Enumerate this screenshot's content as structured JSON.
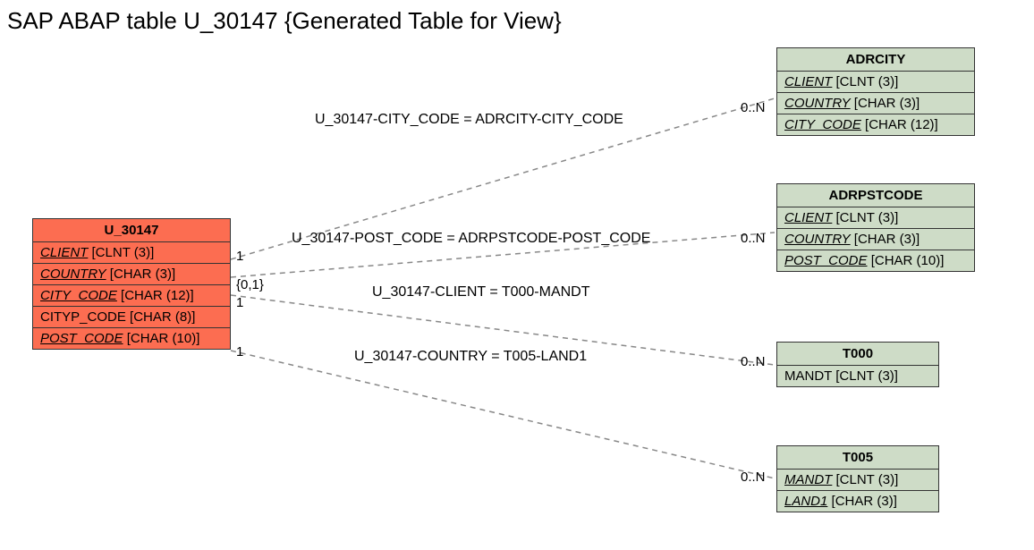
{
  "title": "SAP ABAP table U_30147 {Generated Table for View}",
  "main_table": {
    "name": "U_30147",
    "fields": [
      {
        "name": "CLIENT",
        "type": "[CLNT (3)]"
      },
      {
        "name": "COUNTRY",
        "type": "[CHAR (3)]"
      },
      {
        "name": "CITY_CODE",
        "type": "[CHAR (12)]"
      },
      {
        "name": "CITYP_CODE",
        "type": "[CHAR (8)]",
        "plain": true
      },
      {
        "name": "POST_CODE",
        "type": "[CHAR (10)]"
      }
    ]
  },
  "related_tables": [
    {
      "name": "ADRCITY",
      "fields": [
        {
          "name": "CLIENT",
          "type": "[CLNT (3)]"
        },
        {
          "name": "COUNTRY",
          "type": "[CHAR (3)]"
        },
        {
          "name": "CITY_CODE",
          "type": "[CHAR (12)]"
        }
      ]
    },
    {
      "name": "ADRPSTCODE",
      "fields": [
        {
          "name": "CLIENT",
          "type": "[CLNT (3)]"
        },
        {
          "name": "COUNTRY",
          "type": "[CHAR (3)]"
        },
        {
          "name": "POST_CODE",
          "type": "[CHAR (10)]"
        }
      ]
    },
    {
      "name": "T000",
      "fields": [
        {
          "name": "MANDT",
          "type": "[CLNT (3)]"
        }
      ]
    },
    {
      "name": "T005",
      "fields": [
        {
          "name": "MANDT",
          "type": "[CLNT (3)]"
        },
        {
          "name": "LAND1",
          "type": "[CHAR (3)]"
        }
      ]
    }
  ],
  "relations": [
    {
      "label": "U_30147-CITY_CODE = ADRCITY-CITY_CODE",
      "left_card": "1",
      "right_card": "0..N"
    },
    {
      "label": "U_30147-POST_CODE = ADRPSTCODE-POST_CODE",
      "left_card": "{0,1}",
      "right_card": "0..N"
    },
    {
      "label": "U_30147-CLIENT = T000-MANDT",
      "left_card": "1",
      "right_card": "0..N"
    },
    {
      "label": "U_30147-COUNTRY = T005-LAND1",
      "left_card": "1",
      "right_card": "0..N"
    }
  ]
}
